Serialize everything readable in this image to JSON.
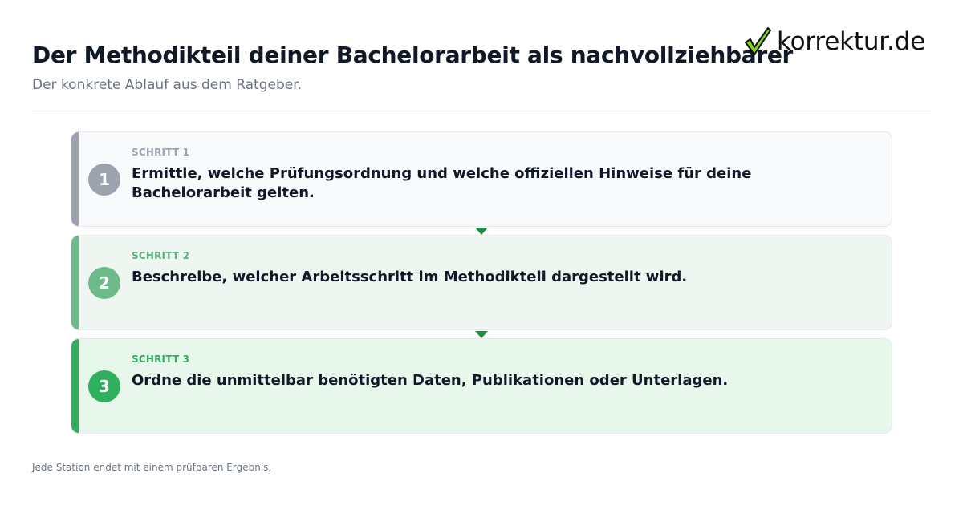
{
  "header": {
    "title": "Der Methodikteil deiner Bachelorarbeit als nachvollziehbarer",
    "subtitle": "Der konkrete Ablauf aus dem Ratgeber."
  },
  "logo": {
    "text": "korrektur.de",
    "icon": "checkmark-icon",
    "check_color": "#7ed321"
  },
  "steps": [
    {
      "number": "1",
      "label": "SCHRITT 1",
      "text": "Ermittle, welche Prüfungsordnung und welche offiziellen Hinweise für deine Bachelorarbeit gelten.",
      "color": "#9ca3af"
    },
    {
      "number": "2",
      "label": "SCHRITT 2",
      "text": "Beschreibe, welcher Arbeitsschritt im Methodikteil dargestellt wird.",
      "color": "#6dba8a"
    },
    {
      "number": "3",
      "label": "SCHRITT 3",
      "text": "Ordne die unmittelbar benötigten Daten, Publikationen oder Unterlagen.",
      "color": "#2fb05d"
    }
  ],
  "connector_color": "#1e8a47",
  "footer": {
    "note": "Jede Station endet mit einem prüfbaren Ergebnis."
  }
}
